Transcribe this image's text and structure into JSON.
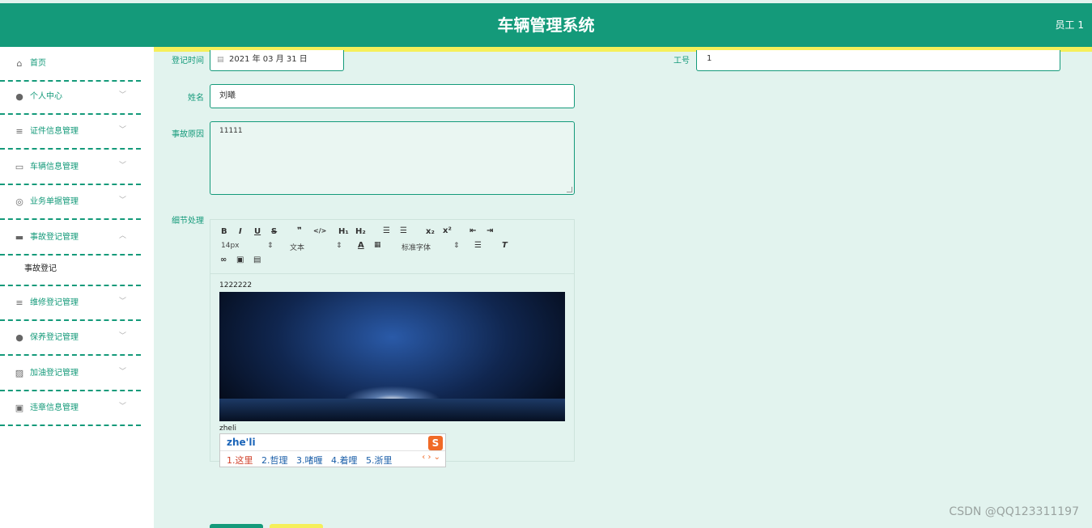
{
  "header": {
    "title": "车辆管理系统",
    "user": "员工 1"
  },
  "sidebar": {
    "items": [
      {
        "label": "首页",
        "icon": "home-icon",
        "glyph": "⌂",
        "chevron": ""
      },
      {
        "label": "个人中心",
        "icon": "user-icon",
        "glyph": "●",
        "chevron": "﹀"
      },
      {
        "label": "证件信息管理",
        "icon": "list-icon",
        "glyph": "≡",
        "chevron": "﹀"
      },
      {
        "label": "车辆信息管理",
        "icon": "message-icon",
        "glyph": "▭",
        "chevron": "﹀"
      },
      {
        "label": "业务单据管理",
        "icon": "compass-icon",
        "glyph": "◎",
        "chevron": "﹀"
      },
      {
        "label": "事故登记管理",
        "icon": "chat-icon",
        "glyph": "▬",
        "chevron": "︿"
      },
      {
        "label": "维修登记管理",
        "icon": "list-icon",
        "glyph": "≡",
        "chevron": "﹀"
      },
      {
        "label": "保养登记管理",
        "icon": "user-icon",
        "glyph": "●",
        "chevron": "﹀"
      },
      {
        "label": "加油登记管理",
        "icon": "chart-icon",
        "glyph": "▨",
        "chevron": "﹀"
      },
      {
        "label": "违章信息管理",
        "icon": "trash-icon",
        "glyph": "▣",
        "chevron": "﹀"
      }
    ],
    "sub_item": "事故登记"
  },
  "form": {
    "date_label": "登记时间",
    "date_value": "2021 年 03 月 31 日",
    "job_no_label": "工号",
    "job_no_value": "1",
    "name_label": "姓名",
    "name_value": "刘曦",
    "reason_label": "事故原因",
    "reason_value": "11111",
    "detail_label": "细节处理"
  },
  "editor": {
    "font_size": "14px",
    "text_style": "文本",
    "font_family": "标准字体",
    "content_line": "1222222",
    "typed": "zheli"
  },
  "ime": {
    "composition": "zhe'li",
    "candidates": [
      "1.这里",
      "2.哲理",
      "3.啫喱",
      "4.着哩",
      "5.浙里"
    ],
    "logo": "S"
  },
  "watermark": "CSDN @QQ123311197",
  "colors": {
    "primary": "#149a7a",
    "accent": "#f5ef5a",
    "background": "#e2f3ee"
  }
}
